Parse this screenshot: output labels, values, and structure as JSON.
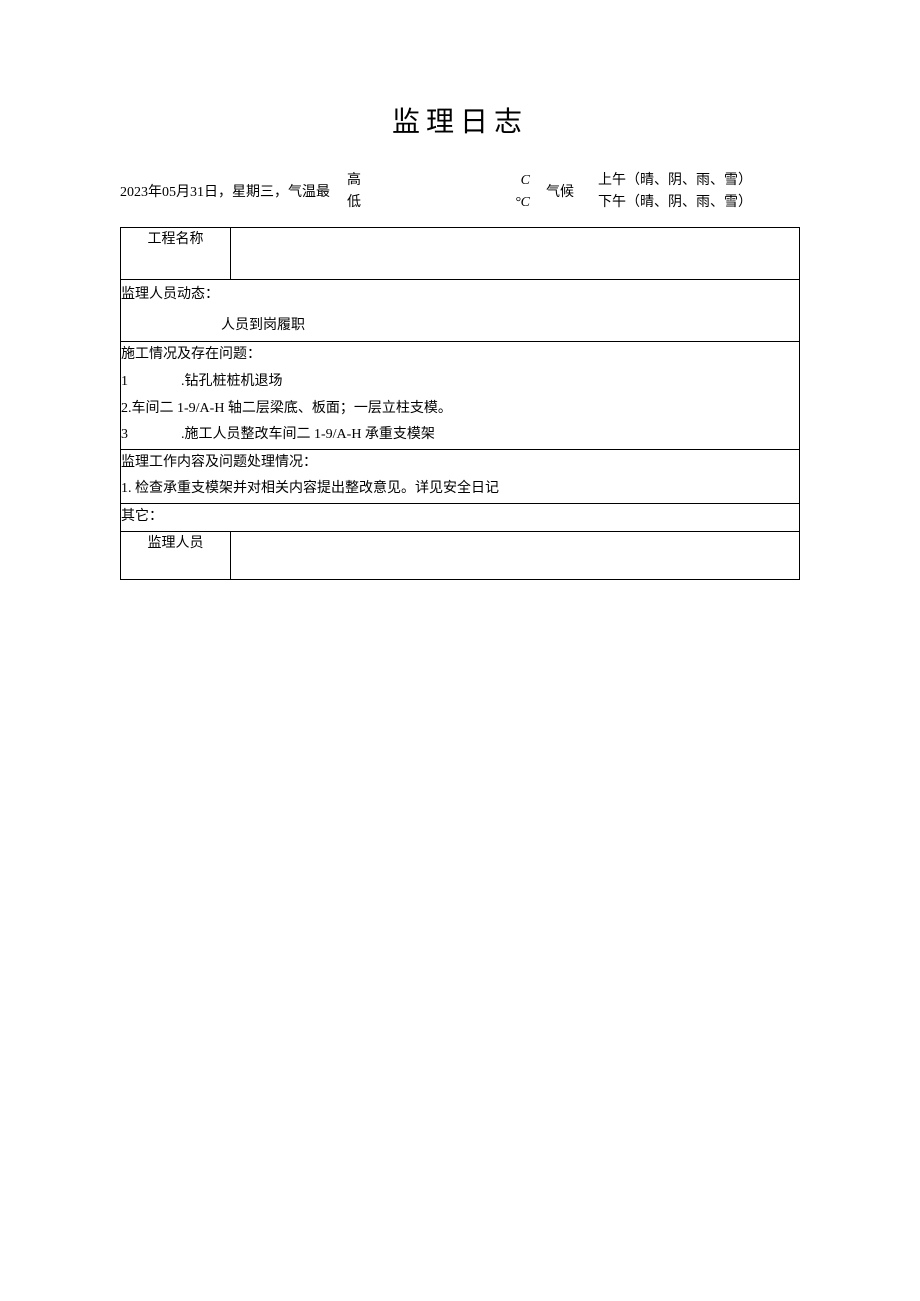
{
  "title": "监理日志",
  "header": {
    "date_text": "2023年05月31日，星期三，气温最",
    "temp_high_label": "高",
    "temp_low_label": "低",
    "temp_high_unit": "C",
    "temp_low_unit": "°C",
    "climate_label": "气候",
    "morning": "上午（晴、阴、雨、雪）",
    "afternoon": "下午（晴、阴、雨、雪）"
  },
  "rows": {
    "project_name_label": "工程名称",
    "project_name_value": "",
    "dynamic_heading": "监理人员动态：",
    "dynamic_line": "人员到岗履职",
    "construction_heading": "施工情况及存在问题：",
    "construction_items": [
      {
        "num": "1",
        "text": ".钻孔桩桩机退场"
      },
      {
        "num": "",
        "text": "2.车间二 1-9/A-H 轴二层梁底、板面；一层立柱支模。"
      },
      {
        "num": "3",
        "text": ".施工人员整改车间二 1-9/A-H 承重支模架"
      }
    ],
    "supervision_heading": "监理工作内容及问题处理情况：",
    "supervision_items": [
      "1. 检查承重支模架并对相关内容提出整改意见。详见安全日记"
    ],
    "other_heading": "其它：",
    "footer_label": "监理人员",
    "footer_value": ""
  }
}
